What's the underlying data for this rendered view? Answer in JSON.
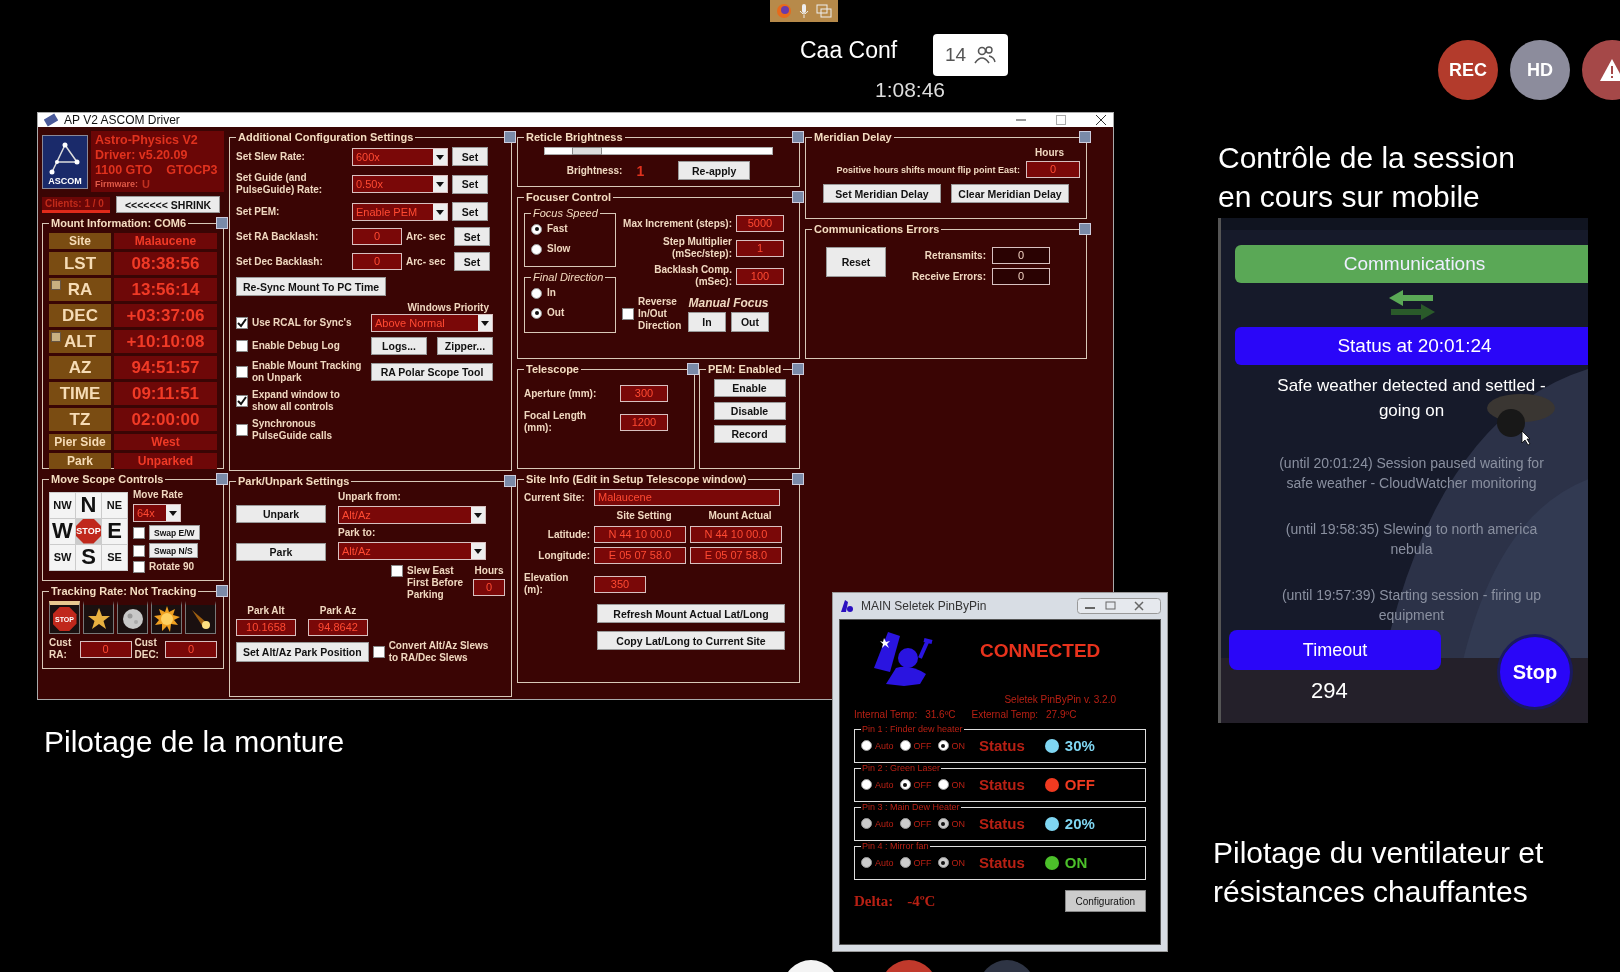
{
  "meeting": {
    "title": "Caa Conf",
    "participants": "14",
    "elapsed": "1:08:46",
    "indicators": [
      {
        "label": "REC",
        "kind": "rec"
      },
      {
        "label": "HD",
        "kind": "hd"
      },
      {
        "kind": "warning"
      }
    ]
  },
  "captions": [
    "Pilotage de la monture",
    "Contrôle de la session\nen cours sur mobile",
    "Pilotage du ventilateur et\nrésistances chauffantes"
  ],
  "ascom": {
    "title": "AP V2 ASCOM Driver",
    "header": {
      "logo": "ASCOM",
      "lines": [
        "Astro-Physics V2",
        "Driver: v5.20.09",
        "1100 GTO    GTOCP3"
      ],
      "firmware_label": "Firmware:",
      "firmware": "U",
      "clients": "Clients: 1 / 0",
      "shrink": "<<<<<<< SHRINK"
    },
    "mount_info": {
      "title": "Mount Information: COM6",
      "rows": [
        {
          "label": "Site",
          "value": "Malaucene",
          "kind": "small"
        },
        {
          "label": "LST",
          "value": "08:38:56",
          "kind": "large"
        },
        {
          "label": "RA",
          "value": "13:56:14",
          "kind": "flagged"
        },
        {
          "label": "DEC",
          "value": "+03:37:06",
          "kind": "large"
        },
        {
          "label": "ALT",
          "value": "+10:10:08",
          "kind": "flagged"
        },
        {
          "label": "AZ",
          "value": "94:51:57",
          "kind": "large"
        },
        {
          "label": "TIME",
          "value": "09:11:51",
          "kind": "large"
        },
        {
          "label": "TZ",
          "value": "02:00:00",
          "kind": "large"
        },
        {
          "label": "Pier Side",
          "value": "West",
          "kind": "small"
        },
        {
          "label": "Park",
          "value": "Unparked",
          "kind": "small"
        }
      ]
    },
    "move_scope": {
      "title": "Move Scope Controls",
      "pad": [
        {
          "label": "NW",
          "kind": "corner"
        },
        {
          "label": "N",
          "kind": "main"
        },
        {
          "label": "NE",
          "kind": "corner"
        },
        {
          "label": "W",
          "kind": "main"
        },
        {
          "label": "STOP",
          "kind": "stop"
        },
        {
          "label": "E",
          "kind": "main"
        },
        {
          "label": "SW",
          "kind": "corner"
        },
        {
          "label": "S",
          "kind": "main"
        },
        {
          "label": "SE",
          "kind": "corner"
        }
      ],
      "rate_label": "Move Rate",
      "rate": "64x",
      "options": [
        {
          "label": "Swap E/W",
          "kind": "button",
          "checked": false
        },
        {
          "label": "Swap N/S",
          "kind": "button",
          "checked": false
        },
        {
          "label": "Rotate 90",
          "kind": "text",
          "checked": false
        }
      ]
    },
    "tracking": {
      "title": "Tracking Rate: Not Tracking",
      "rates": [
        {
          "kind": "stop",
          "label": "STOP",
          "selected": true
        },
        {
          "kind": "star",
          "selected": false
        },
        {
          "kind": "moon",
          "selected": false
        },
        {
          "kind": "sun",
          "selected": false
        },
        {
          "kind": "comet",
          "selected": false
        }
      ],
      "custom": [
        {
          "label": "Cust RA:",
          "value": "0"
        },
        {
          "label": "Cust DEC:",
          "value": "0"
        }
      ]
    },
    "config": {
      "title": "Additional Configuration Settings",
      "settings": [
        {
          "label": "Set Slew Rate:",
          "kind": "select",
          "value": "600x",
          "button": "Set"
        },
        {
          "label": "Set Guide (and PulseGuide) Rate:",
          "kind": "select",
          "value": "0.50x",
          "button": "Set"
        },
        {
          "label": "Set PEM:",
          "kind": "select",
          "value": "Enable PEM",
          "button": "Set"
        },
        {
          "label": "Set RA Backlash:",
          "kind": "input",
          "value": "0",
          "unit": "Arc- sec",
          "button": "Set"
        },
        {
          "label": "Set Dec Backlash:",
          "kind": "input",
          "value": "0",
          "unit": "Arc- sec",
          "button": "Set"
        }
      ],
      "resync": "Re-Sync Mount To PC Time",
      "priority_label": "Windows Priority",
      "priority": "Above Normal",
      "checks": [
        {
          "label": "Use RCAL for Sync's",
          "checked": true,
          "kind": "priority"
        },
        {
          "label": "Enable Debug Log",
          "checked": false,
          "kind": "buttons",
          "buttons": [
            "Logs...",
            "Zipper..."
          ]
        },
        {
          "label": "Enable Mount Tracking on Unpark",
          "checked": false,
          "kind": "buttons",
          "buttons": [
            "RA Polar Scope Tool"
          ]
        },
        {
          "label": "Expand window to show all controls",
          "checked": true,
          "kind": "plain"
        },
        {
          "label": "Synchronous PulseGuide calls",
          "checked": false,
          "kind": "plain"
        }
      ]
    },
    "park": {
      "title": "Park/Unpark Settings",
      "unpark": "Unpark",
      "park": "Park",
      "unpark_from_label": "Unpark from:",
      "unpark_from": "Alt/Az",
      "park_to_label": "Park to:",
      "park_to": "Alt/Az",
      "slew_east": {
        "label": "Slew East First Before Parking",
        "checked": false
      },
      "hours_label": "Hours",
      "hours": "0",
      "park_alt_label": "Park Alt",
      "park_alt": "10.1658",
      "park_az_label": "Park Az",
      "park_az": "94.8642",
      "set_button": "Set Alt/Az Park Position",
      "convert": {
        "label": "Convert Alt/Az Slews to RA/Dec Slews",
        "checked": false
      }
    },
    "reticle": {
      "title": "Reticle Brightness",
      "level": 0.12,
      "brightness_label": "Brightness:",
      "brightness": "1",
      "button": "Re-apply"
    },
    "focuser": {
      "title": "Focuser Control",
      "speed_title": "Focus Speed",
      "speeds": [
        {
          "label": "Fast",
          "selected": true
        },
        {
          "label": "Slow",
          "selected": false
        }
      ],
      "direction_title": "Final Direction",
      "directions": [
        {
          "label": "In",
          "selected": false
        },
        {
          "label": "Out",
          "selected": true
        }
      ],
      "fields": [
        {
          "label": "Max Increment (steps):",
          "value": "5000"
        },
        {
          "label": "Step Multiplier (mSec/step):",
          "value": "1"
        },
        {
          "label": "Backlash Comp. (mSec):",
          "value": "100"
        }
      ],
      "reverse": {
        "label": "Reverse In/Out Direction",
        "checked": false
      },
      "manual_title": "Manual Focus",
      "manual_buttons": [
        "In",
        "Out"
      ]
    },
    "telescope": {
      "title": "Telescope",
      "fields": [
        {
          "label": "Aperture (mm):",
          "value": "300"
        },
        {
          "label": "Focal Length (mm):",
          "value": "1200"
        }
      ]
    },
    "pem": {
      "title": "PEM: Enabled",
      "buttons": [
        "Enable",
        "Disable",
        "Record"
      ]
    },
    "site": {
      "title": "Site Info (Edit in Setup Telescope window)",
      "current_label": "Current Site:",
      "current": "Malaucene",
      "columns": [
        "Site Setting",
        "Mount Actual"
      ],
      "rows": [
        {
          "label": "Latitude:",
          "values": [
            "N 44 10 00.0",
            "N 44 10 00.0"
          ]
        },
        {
          "label": "Longitude:",
          "values": [
            "E 05 07 58.0",
            "E 05 07 58.0"
          ]
        }
      ],
      "elevation_label": "Elevation (m):",
      "elevation": "350",
      "buttons": [
        "Refresh Mount Actual Lat/Long",
        "Copy Lat/Long to Current Site"
      ]
    },
    "meridian": {
      "title": "Meridian Delay",
      "hours_label": "Hours",
      "label": "Positive hours shifts mount flip point East:",
      "value": "0",
      "buttons": [
        "Set Meridian Delay",
        "Clear Meridian Delay"
      ]
    },
    "comm": {
      "title": "Communications Errors",
      "button": "Reset",
      "fields": [
        {
          "label": "Retransmits:",
          "value": "0"
        },
        {
          "label": "Receive Errors:",
          "value": "0"
        }
      ]
    }
  },
  "phone": {
    "header": "Communications",
    "status": "Status at 20:01:24",
    "message": "Safe weather detected and settled - going on",
    "log": [
      "(until 20:01:24) Session paused waiting for safe weather - CloudWatcher monitoring",
      "(until 19:58:35) Slewing to north america nebula",
      "(until 19:57:39) Starting session - firing up equipment"
    ],
    "timeout_label": "Timeout",
    "timeout": "294",
    "stop": "Stop"
  },
  "pinbypin": {
    "title": "MAIN Seletek PinByPin",
    "status": "CONNECTED",
    "version": "Seletek PinByPin v. 3.2.0",
    "temps": [
      {
        "label": "Internal Temp:",
        "value": "31.6ºC"
      },
      {
        "label": "External Temp:",
        "value": "27.9ºC"
      }
    ],
    "pins": [
      {
        "name": "Pin 1 : Finder dew heater",
        "modes": [
          {
            "label": "Auto",
            "selected": false
          },
          {
            "label": "OFF",
            "selected": false
          },
          {
            "label": "ON",
            "selected": true
          }
        ],
        "status_label": "Status",
        "value": "30%",
        "color": "#7fd6f2"
      },
      {
        "name": "Pin 2 : Green Laser",
        "modes": [
          {
            "label": "Auto",
            "selected": false
          },
          {
            "label": "OFF",
            "selected": true
          },
          {
            "label": "ON",
            "selected": false
          }
        ],
        "status_label": "Status",
        "value": "OFF",
        "color": "#f03a20"
      },
      {
        "name": "Pin 3 : Main Dew Heater",
        "modes": [
          {
            "label": "Auto",
            "selected": false
          },
          {
            "label": "OFF",
            "selected": false
          },
          {
            "label": "ON",
            "selected": true
          }
        ],
        "status_label": "Status",
        "value": "20%",
        "color": "#7fd6f2"
      },
      {
        "name": "Pin 4 : Mirror fan",
        "modes": [
          {
            "label": "Auto",
            "selected": false
          },
          {
            "label": "OFF",
            "selected": false
          },
          {
            "label": "ON",
            "selected": true
          }
        ],
        "status_label": "Status",
        "value": "ON",
        "color": "#4cc02a"
      }
    ],
    "delta_label": "Delta:",
    "delta": "-4ºC",
    "button": "Configuration"
  }
}
